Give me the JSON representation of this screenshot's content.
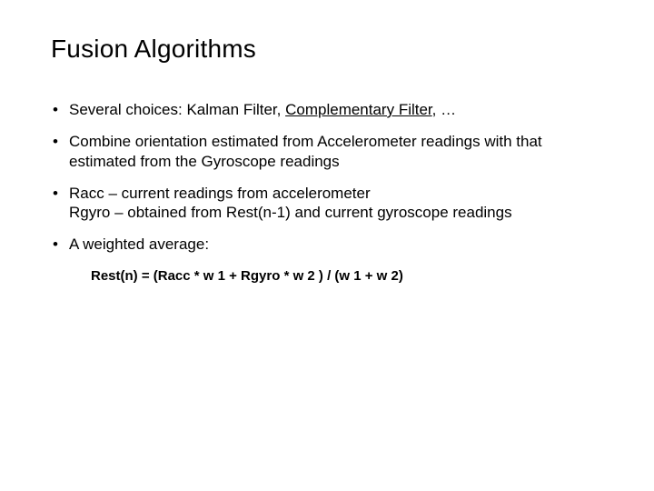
{
  "title": "Fusion Algorithms",
  "bullets": [
    {
      "segments": [
        {
          "text": "Several choices: Kalman Filter, "
        },
        {
          "text": "Complementary Filter",
          "underline": true
        },
        {
          "text": ", …"
        }
      ]
    },
    {
      "segments": [
        {
          "text": "Combine orientation estimated from Accelerometer readings with that estimated from the Gyroscope readings"
        }
      ]
    },
    {
      "segments": [
        {
          "text": "Racc – current readings from accelerometer\nRgyro – obtained from Rest(n-1) and current gyroscope readings"
        }
      ]
    },
    {
      "segments": [
        {
          "text": "A weighted average:"
        }
      ]
    }
  ],
  "formula": "Rest(n) = (Racc * w 1 + Rgyro * w 2 ) / (w 1 + w 2)"
}
